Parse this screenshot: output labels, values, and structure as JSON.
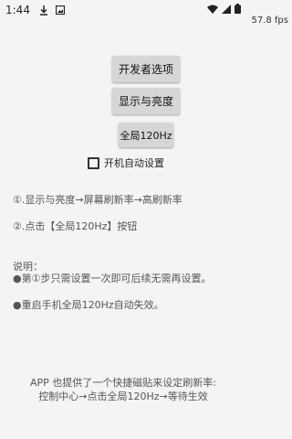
{
  "status_bar": {
    "time": "1:44",
    "icons_left": [
      "download-icon",
      "image-icon"
    ],
    "icons_right": [
      "wifi-icon",
      "signal-icon",
      "battery-icon"
    ]
  },
  "fps": "57.8 fps",
  "buttons": {
    "dev_options": "开发者选项",
    "display_brightness": "显示与亮度",
    "global_120hz": "全局120Hz"
  },
  "checkbox": {
    "label": "开机自动设置",
    "checked": false
  },
  "steps": {
    "step1": "①.显示与亮度→屏幕刷新率→高刷新率",
    "step2": "②.点击【全局120Hz】按钮"
  },
  "notes": {
    "title": "说明：",
    "note1": "●第①步只需设置一次即可后续无需再设置。",
    "note2": "●重启手机全局120Hz自动失效。"
  },
  "footer": {
    "line1": "APP 也提供了一个快捷磁贴来设定刷新率:",
    "line2": "控制中心→点击全局120Hz→等待生效"
  }
}
